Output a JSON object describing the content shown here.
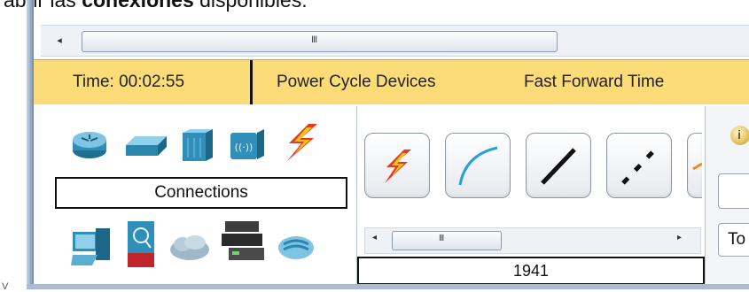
{
  "caption": {
    "prefix": "abrir las ",
    "bold": "conexiones",
    "suffix": " disponibles."
  },
  "scrollbar": {
    "left_arrow": "◂",
    "grip": "III"
  },
  "timebar": {
    "time_label": "Time: 00:02:55",
    "power_cycle": "Power Cycle Devices",
    "fast_forward": "Fast Forward Time"
  },
  "device_panel": {
    "category_label": "Connections",
    "top_row_icons": [
      "router-icon",
      "switch-icon",
      "hub-icon",
      "wireless-device-icon",
      "connections-lightning-icon"
    ],
    "bottom_row_icons": [
      "end-device-icon",
      "security-device-icon",
      "wan-emulation-icon",
      "custom-device-icon",
      "multiuser-connection-icon"
    ]
  },
  "subtype_panel": {
    "tiles": [
      "automatic-connection-icon",
      "console-cable-icon",
      "copper-straight-through-icon",
      "copper-cross-over-icon"
    ],
    "scroll_left": "◂",
    "scroll_grip": "III",
    "scroll_right": "▸",
    "model_label": "1941"
  },
  "right_panel": {
    "button2_label": "To"
  },
  "colors": {
    "timebar_bg": "#fbdc78",
    "accent_blue": "#2a9fd6",
    "lightning_red": "#e53b1c",
    "lightning_yellow": "#ffc21a"
  }
}
